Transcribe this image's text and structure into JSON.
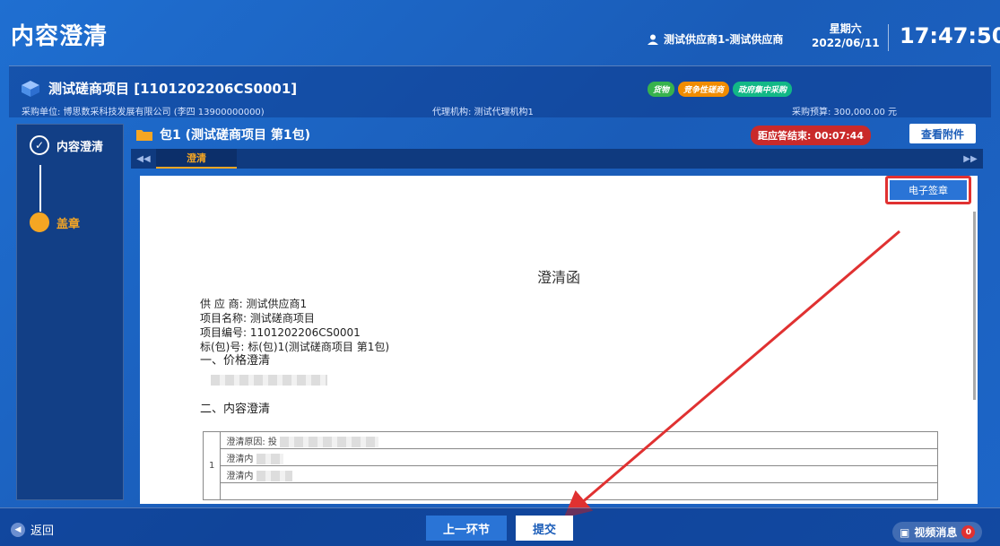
{
  "header": {
    "title": "内容澄清",
    "user": "测试供应商1-测试供应商",
    "weekday": "星期六",
    "date": "2022/06/11",
    "time": "17:47:50"
  },
  "project": {
    "title": "测试磋商项目 [1101202206CS0001]",
    "tags": [
      "货物",
      "竞争性磋商",
      "政府集中采购"
    ],
    "purchaser": "采购单位: 博思数采科技发展有限公司 (李四 13900000000)",
    "agency": "代理机构: 测试代理机构1",
    "budget": "采购预算: 300,000.00 元"
  },
  "sidebar": {
    "steps": [
      {
        "label": "内容澄清",
        "state": "done"
      },
      {
        "label": "盖章",
        "state": "current"
      }
    ]
  },
  "package": {
    "title": "包1 (测试磋商项目 第1包)",
    "countdown": "距应答结束: 00:07:44",
    "attach_label": "查看附件"
  },
  "tabs": {
    "active": "澄清",
    "prev_icon": "◀◀",
    "next_icon": "▶▶"
  },
  "document": {
    "esign_label": "电子签章",
    "letter_title": "澄清函",
    "supplier": "供 应 商: 测试供应商1",
    "project_name": "项目名称: 测试磋商项目",
    "project_no": "项目编号: 1101202206CS0001",
    "package_no": "标(包)号: 标(包)1(测试磋商项目 第1包)",
    "section1": "一、价格澄清",
    "section2": "二、内容澄清",
    "row_index": "1",
    "row1": "澄清原因: 投",
    "row2": "澄清内",
    "row3": "澄清内"
  },
  "footer": {
    "back_label": "返回",
    "prev_label": "上一环节",
    "submit_label": "提交",
    "video_label": "视频消息",
    "video_count": "0"
  },
  "colors": {
    "accent": "#1a5cb8",
    "highlight": "#f5a623",
    "alert": "#e03131"
  }
}
